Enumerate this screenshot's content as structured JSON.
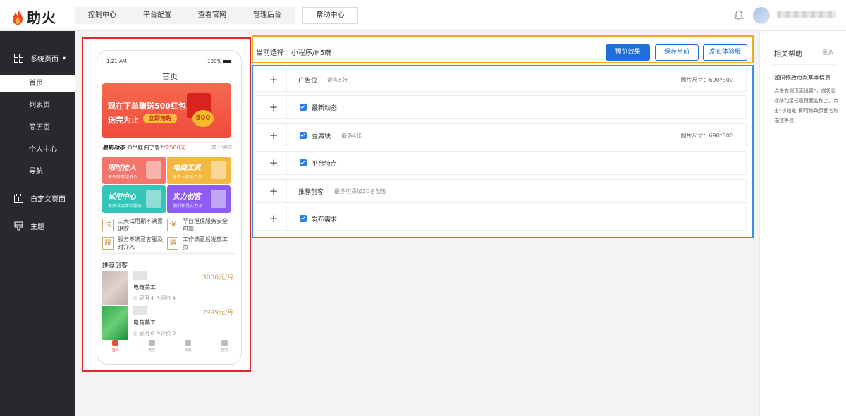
{
  "brand": {
    "name": "助火"
  },
  "topnav": {
    "items": [
      "控制中心",
      "平台配置",
      "查看官网",
      "管理后台"
    ],
    "help": "帮助中心"
  },
  "sidebar": {
    "group1": "系统页面",
    "items": [
      "首页",
      "列表页",
      "简历页",
      "个人中心",
      "导航"
    ],
    "group2": "自定义页面",
    "group3": "主题"
  },
  "phone": {
    "time": "1:21 AM",
    "battery": "100%",
    "title": "首页",
    "banner": {
      "line1": "现在下单赠送500红包",
      "line2": "送完为止",
      "button": "立即抢购",
      "coin": "500"
    },
    "news": {
      "tag": "最新动态",
      "text_prefix": "O**雇佣了鲁*",
      "amount": "*2500元",
      "time": "35分钟前"
    },
    "cards": [
      {
        "title": "限时抢入",
        "sub": "天天特惠超低价",
        "color": "#f2766b"
      },
      {
        "title": "电商工具",
        "sub": "总有一款适合你",
        "color": "#f4b740"
      },
      {
        "title": "试用中心",
        "sub": "免费试用体验服务",
        "color": "#33c5b7"
      },
      {
        "title": "实力创客",
        "sub": "他们都是实力派",
        "color": "#8e5cf0"
      }
    ],
    "features": [
      {
        "icon": "试",
        "text": "三天试用期不满意退款"
      },
      {
        "icon": "保",
        "text": "平台担保服务安全可靠"
      },
      {
        "icon": "服",
        "text": "服务不满意客服及时介入"
      },
      {
        "icon": "满",
        "text": "工作满意后发放工资"
      }
    ],
    "recommend_title": "推荐创客",
    "items": [
      {
        "name": "电商美工",
        "employ": "雇佣 4",
        "review": "评价 4",
        "price": "3000元/月"
      },
      {
        "name": "电商美工",
        "employ": "雇佣 0",
        "review": "评价 0",
        "price": "2999元/月"
      }
    ],
    "tabs": [
      "首页",
      "发文",
      "消息",
      "我的"
    ]
  },
  "editor": {
    "current_label": "当前选择：小程序/H5端",
    "preview_btn": "预览效果",
    "save_btn": "保存当前",
    "publish_btn": "发布体验版"
  },
  "modules": [
    {
      "name": "广告位",
      "note": "最多5张",
      "size": "图片尺寸：690*300",
      "checked": false
    },
    {
      "name": "最新动态",
      "note": "",
      "size": "",
      "checked": true
    },
    {
      "name": "豆腐块",
      "note": "最多4张",
      "size": "图片尺寸：690*300",
      "checked": true
    },
    {
      "name": "平台特点",
      "note": "",
      "size": "",
      "checked": true
    },
    {
      "name": "推荐创客",
      "note": "最多可添加20名创客",
      "size": "",
      "checked": false
    },
    {
      "name": "发布需求",
      "note": "",
      "size": "",
      "checked": true
    }
  ],
  "help": {
    "title": "相关帮助",
    "more": "更多",
    "question": "如何修改页面基本信息",
    "answer": "点击右侧页面设置”，或将鼠标移动至任意页面名称上，点击“小铅笔”即可修改页面名称描述等信"
  },
  "colors": {
    "accent": "#1d6fdb",
    "preview_border": "#e02a2a",
    "head_border": "#f5a623",
    "modules_border": "#3a8ee6",
    "sidebar_bg": "#28292d"
  }
}
